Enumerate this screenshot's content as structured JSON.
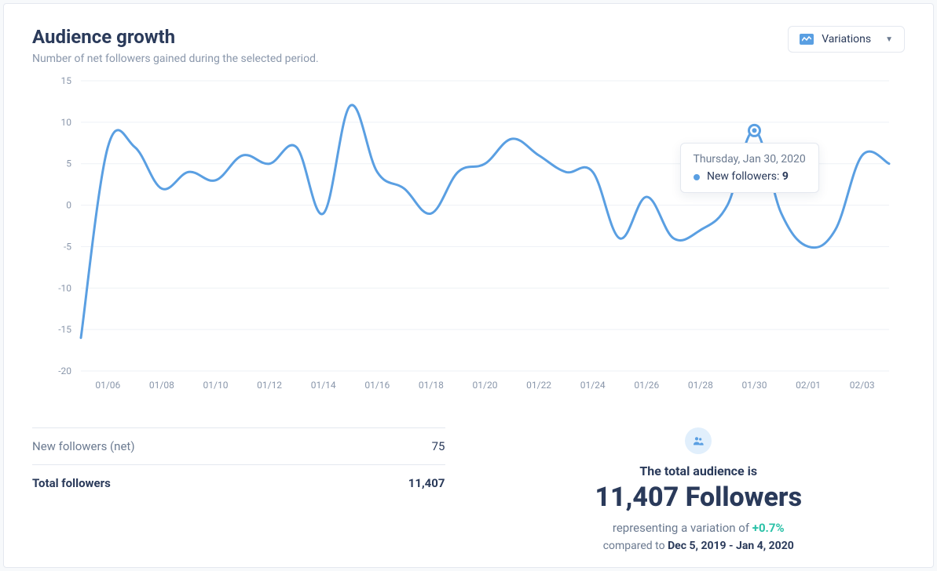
{
  "header": {
    "title": "Audience growth",
    "subtitle": "Number of net followers gained during the selected period.",
    "dropdown_label": "Variations"
  },
  "tooltip": {
    "date_label": "Thursday, Jan 30, 2020",
    "series_label": "New followers:",
    "value": "9",
    "on_index": 25
  },
  "stats": {
    "net_label": "New followers (net)",
    "net_value": "75",
    "total_label": "Total followers",
    "total_value": "11,407"
  },
  "summary": {
    "line1": "The total audience is",
    "big": "11,407 Followers",
    "line3_prefix": "representing a variation of ",
    "pct": "+0.7%",
    "line4_prefix": "compared to ",
    "compare_range": "Dec 5, 2019 - Jan 4, 2020"
  },
  "chart_data": {
    "type": "line",
    "title": "Audience growth",
    "xlabel": "",
    "ylabel": "",
    "ylim": [
      -20,
      15
    ],
    "yticks": [
      -20,
      -15,
      -10,
      -5,
      0,
      5,
      10,
      15
    ],
    "xticks": [
      "01/06",
      "01/08",
      "01/10",
      "01/12",
      "01/14",
      "01/16",
      "01/18",
      "01/20",
      "01/22",
      "01/24",
      "01/26",
      "01/28",
      "01/30",
      "02/01",
      "02/03"
    ],
    "series": [
      {
        "name": "New followers",
        "color": "#5a9fe2",
        "x": [
          "01/05",
          "01/06",
          "01/07",
          "01/08",
          "01/09",
          "01/10",
          "01/11",
          "01/12",
          "01/13",
          "01/14",
          "01/15",
          "01/16",
          "01/17",
          "01/18",
          "01/19",
          "01/20",
          "01/21",
          "01/22",
          "01/23",
          "01/24",
          "01/25",
          "01/26",
          "01/27",
          "01/28",
          "01/29",
          "01/30",
          "01/31",
          "02/01",
          "02/02",
          "02/03",
          "02/04"
        ],
        "values": [
          -16,
          7,
          7,
          2,
          4,
          3,
          6,
          5,
          7,
          -1,
          12,
          4,
          2,
          -1,
          4,
          5,
          8,
          6,
          4,
          4,
          -4,
          1,
          -4,
          -3,
          0,
          9,
          -1,
          -5,
          -3,
          6,
          5
        ]
      }
    ]
  }
}
